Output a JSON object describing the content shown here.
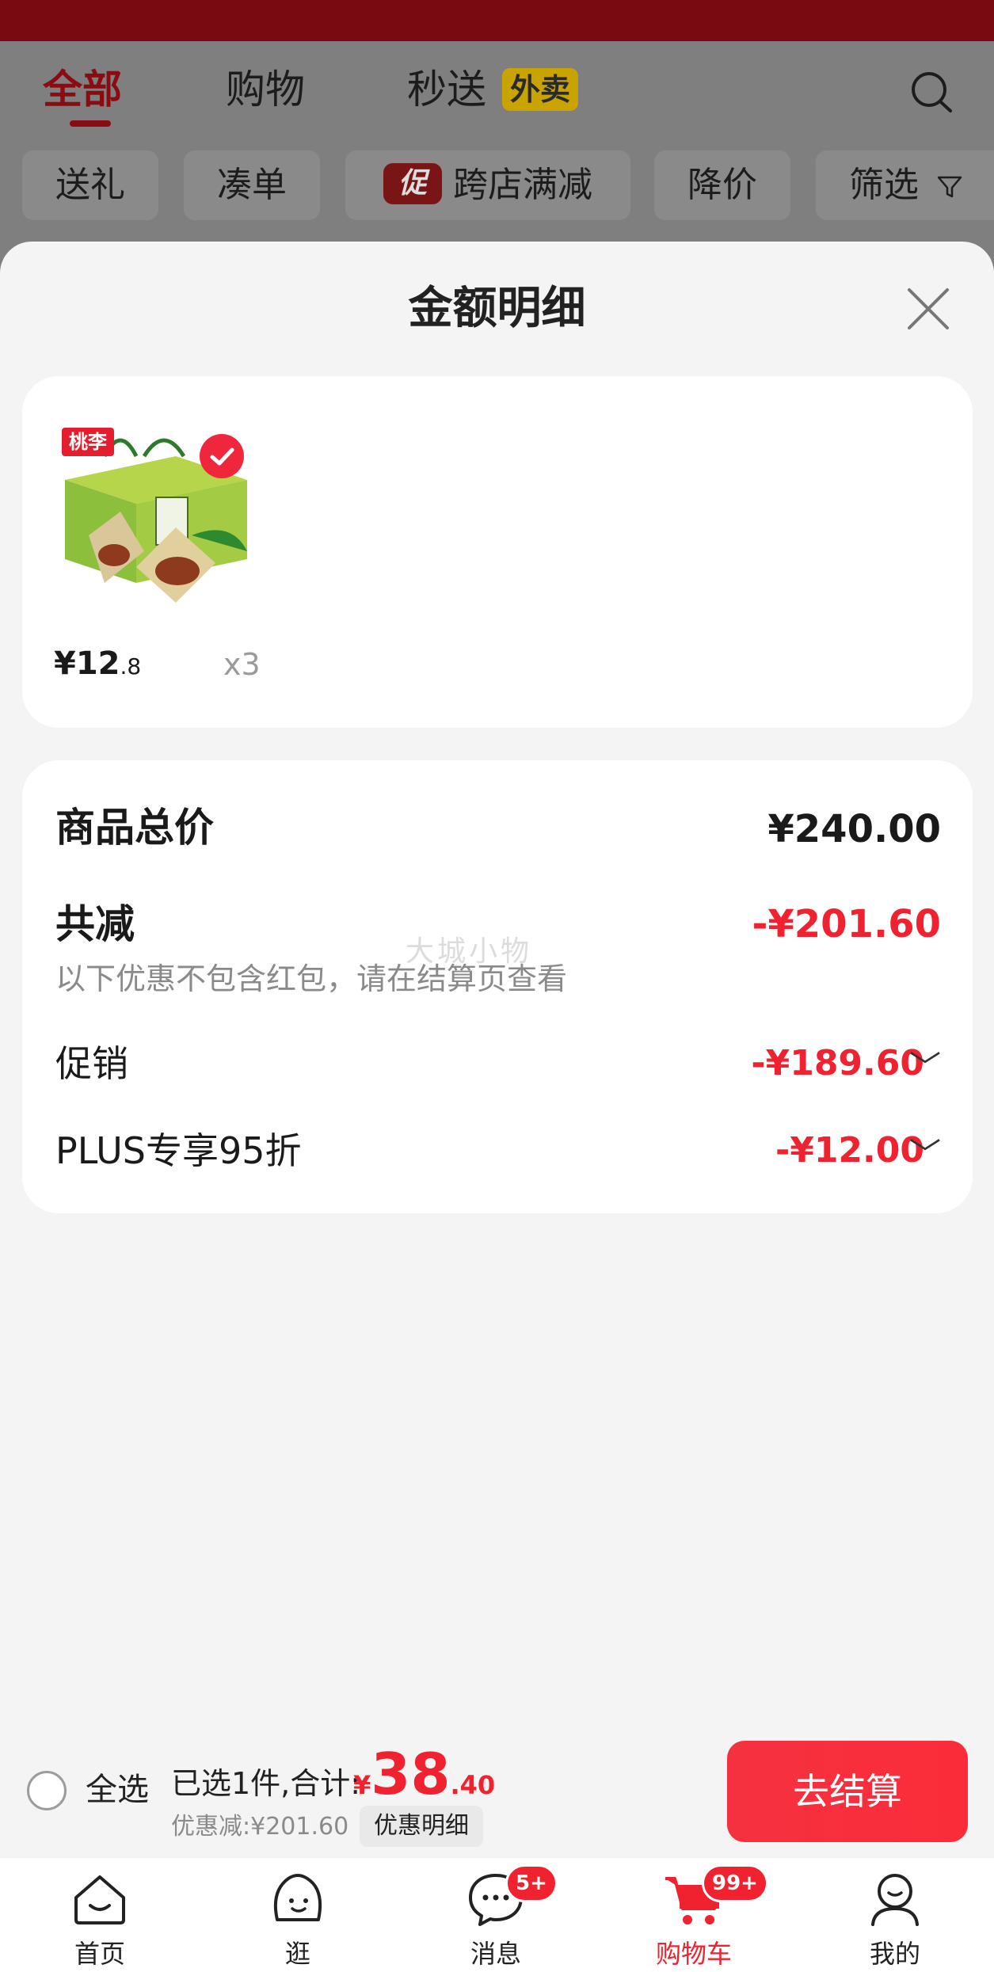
{
  "header": {
    "tabs": [
      "全部",
      "购物",
      "秒送"
    ],
    "takeout_badge": "外卖",
    "chips": {
      "gift": "送礼",
      "combine": "凑单",
      "cross_badge": "促",
      "cross": "跨店满减",
      "drop": "降价",
      "filter": "筛选"
    }
  },
  "sheet": {
    "title": "金额明细"
  },
  "product": {
    "brand_tag": "桃李",
    "price_main": "¥12",
    "price_decimal": ".8",
    "quantity": "x3"
  },
  "summary": {
    "total_label": "商品总价",
    "total_value": "¥240.00",
    "discount_label": "共减",
    "discount_value": "-¥201.60",
    "discount_note": "以下优惠不包含红包，请在结算页查看",
    "watermark": "大城小物",
    "promo_label": "促销",
    "promo_value": "-¥189.60",
    "plus_label": "PLUS专享95折",
    "plus_value": "-¥12.00"
  },
  "checkout": {
    "select_all": "全选",
    "selected_text": "已选1件,合计:",
    "currency": "¥",
    "amount_int": "38",
    "amount_dec": ".40",
    "saved_text": "优惠减:¥201.60",
    "detail_button": "优惠明细",
    "checkout_button": "去结算"
  },
  "nav": {
    "home": "首页",
    "browse": "逛",
    "messages": "消息",
    "messages_badge": "5+",
    "cart": "购物车",
    "cart_badge": "99+",
    "mine": "我的"
  },
  "colors": {
    "accent": "#f0222f",
    "brand_dark": "#7a0a12"
  }
}
